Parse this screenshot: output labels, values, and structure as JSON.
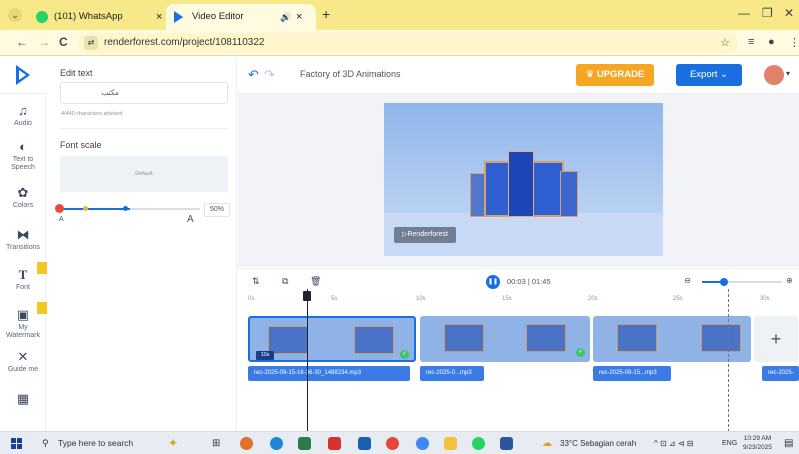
{
  "browser": {
    "tabs": [
      {
        "title": "(101) WhatsApp",
        "close": "×"
      },
      {
        "title": "Video Editor",
        "close": "×",
        "audio": "🔊"
      }
    ],
    "new_tab": "+",
    "window_controls": [
      "—",
      "❐",
      "✕"
    ],
    "nav": {
      "back": "←",
      "forward": "→",
      "reload": "C"
    },
    "url": "renderforest.com/project/108110322",
    "star": "☆"
  },
  "app": {
    "project_title": "Factory of 3D Animations",
    "upgrade_label": "UPGRADE",
    "export_label": "Export",
    "undo": "↶",
    "redo": "↷"
  },
  "rail": {
    "items": [
      {
        "icon": "♫",
        "label": "Audio"
      },
      {
        "icon": "◐",
        "label": "Text to Speech"
      },
      {
        "icon": "✿",
        "label": "Colors"
      },
      {
        "icon": "⧓",
        "label": "Transitions"
      },
      {
        "icon": "T",
        "label": "Font"
      },
      {
        "icon": "▣",
        "label": "My Watermark"
      },
      {
        "icon": "✕",
        "label": "Guide me"
      },
      {
        "icon": "▦",
        "label": ""
      }
    ]
  },
  "edit_panel": {
    "title": "Edit text",
    "text_value": "مكتب",
    "char_hint": "4/440 characters advised",
    "font_scale_title": "Font scale",
    "scale_preview": "Default",
    "slider_small": "A",
    "slider_large": "A",
    "scale_percent": "50%",
    "scale_level": 0.5
  },
  "preview": {
    "watermark": "▷Renderforest"
  },
  "timeline": {
    "tools": [
      "⇅",
      "⧉",
      "🗑"
    ],
    "time": "00:03 | 01:45",
    "play": "❚❚",
    "zoom_out": "⊖",
    "zoom_in": "⊕",
    "zoom_level": 0.28,
    "ruler": [
      "0s",
      "5s",
      "10s",
      "15s",
      "20s",
      "25s",
      "30s"
    ],
    "clips": [
      {
        "duration": "10s",
        "selected": true
      },
      {
        "duration": "",
        "selected": false
      },
      {
        "duration": "",
        "selected": false
      }
    ],
    "add": "+",
    "audio_tracks": [
      "rec-2025-09-15-16-36-30_1488234.mp3",
      "rec-2025-0...mp3",
      "rec-2025-09-15...mp3",
      "rec-2025-"
    ]
  },
  "taskbar": {
    "search_placeholder": "Type here to search",
    "weather": "33°C Sebagian cerah",
    "lang": "ENG",
    "time": "10:29 AM",
    "date": "9/23/2025",
    "tray": "^ ⊡ ⊿ ⊲ ⊟"
  },
  "colors": {
    "accent": "#1a6fe0",
    "upgrade": "#f6a623",
    "tabstrip": "#f7e98a"
  }
}
